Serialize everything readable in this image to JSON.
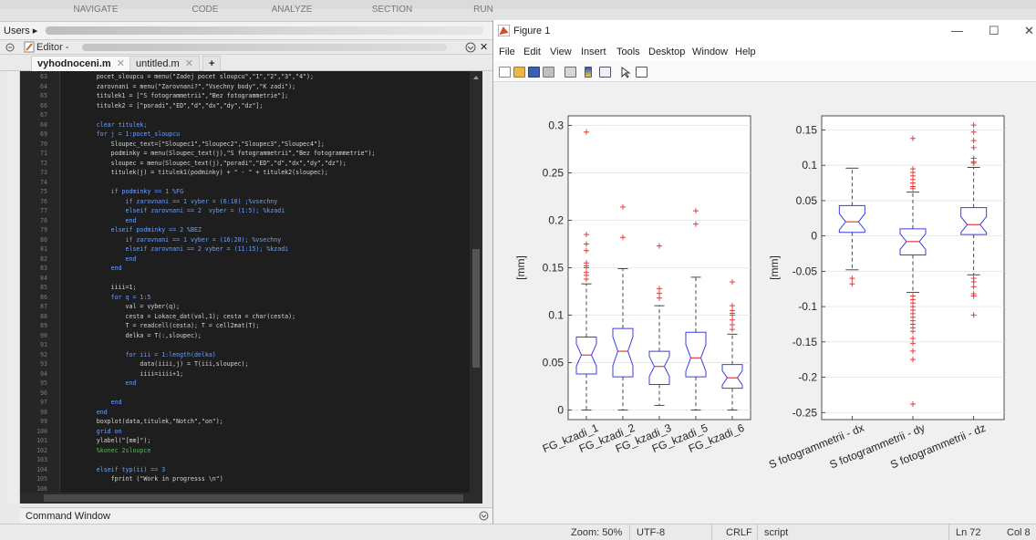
{
  "ribbon": {
    "tabs": [
      "NAVIGATE",
      "CODE",
      "ANALYZE",
      "SECTION",
      "RUN"
    ]
  },
  "path": {
    "label": "Users",
    "arrow": "▸"
  },
  "editor": {
    "title": "Editor -",
    "tabs": [
      {
        "label": "vyhodnoceni.m",
        "active": true
      },
      {
        "label": "untitled.m",
        "active": false
      }
    ],
    "add_tab": "+",
    "close_glyph": "✕",
    "lines": [
      {
        "n": "63",
        "t": "        pocet_sloupcu = menu(\"Zadej pocet sloupcu\",\"1\",\"2\",\"3\",\"4\");"
      },
      {
        "n": "64",
        "t": "        zarovnani = menu(\"Zarovnani?\",\"Vsechny body\",\"K zadi\");"
      },
      {
        "n": "65",
        "t": "        titulek1 = [\"S fotogrammetrii\",\"Bez fotogrammetrie\"];"
      },
      {
        "n": "66",
        "t": "        titulek2 = [\"poradi\",\"ED\",\"d\",\"dx\",\"dy\",\"dz\"];"
      },
      {
        "n": "67",
        "t": ""
      },
      {
        "n": "68",
        "t": "        clear titulek;"
      },
      {
        "n": "69",
        "t": "        for j = 1:pocet_sloupcu"
      },
      {
        "n": "70",
        "t": "            Sloupec_text=[\"Sloupec1\",\"Sloupec2\",\"Sloupec3\",\"Sloupec4\"];"
      },
      {
        "n": "71",
        "t": "            podminky = menu(Sloupec_text(j),\"S fotogrammetrii\",\"Bez fotogrammetrie\");"
      },
      {
        "n": "72",
        "t": "            sloupec = menu(Sloupec_text(j),\"poradi\",\"ED\",\"d\",\"dx\",\"dy\",\"dz\");"
      },
      {
        "n": "73",
        "t": "            titulek(j) = titulek1(podminky) + \" - \" + titulek2(sloupec);"
      },
      {
        "n": "74",
        "t": ""
      },
      {
        "n": "75",
        "t": "            if podminky == 1 %FG"
      },
      {
        "n": "76",
        "t": "                if zarovnani == 1 vyber = (6:10) ;%vsechny"
      },
      {
        "n": "77",
        "t": "                elseif zarovnani == 2  vyber = (1:5); %kzadi"
      },
      {
        "n": "78",
        "t": "                end"
      },
      {
        "n": "79",
        "t": "            elseif podminky == 2 %BEZ"
      },
      {
        "n": "80",
        "t": "                if zarovnani == 1 vyber = (16:20); %vsechny"
      },
      {
        "n": "81",
        "t": "                elseif zarovnani == 2 vyber = (11:15); %kzadi"
      },
      {
        "n": "82",
        "t": "                end"
      },
      {
        "n": "83",
        "t": "            end"
      },
      {
        "n": "84",
        "t": ""
      },
      {
        "n": "85",
        "t": "            iiii=1;"
      },
      {
        "n": "86",
        "t": "            for q = 1:5"
      },
      {
        "n": "87",
        "t": "                val = vyber(q);"
      },
      {
        "n": "88",
        "t": "                cesta = Lokace_dat(val,1); cesta = char(cesta);"
      },
      {
        "n": "89",
        "t": "                T = readcell(cesta); T = cell2mat(T);"
      },
      {
        "n": "90",
        "t": "                delka = T(:,sloupec);"
      },
      {
        "n": "91",
        "t": ""
      },
      {
        "n": "92",
        "t": "                for iii = 1:length(delka)"
      },
      {
        "n": "93",
        "t": "                    data(iiii,j) = T(iii,sloupec);"
      },
      {
        "n": "94",
        "t": "                    iiii=iiii+1;"
      },
      {
        "n": "95",
        "t": "                end"
      },
      {
        "n": "96",
        "t": ""
      },
      {
        "n": "97",
        "t": "            end"
      },
      {
        "n": "98",
        "t": "        end"
      },
      {
        "n": "99",
        "t": "        boxplot(data,titulek,\"Notch\",\"on\");"
      },
      {
        "n": "100",
        "t": "        grid on"
      },
      {
        "n": "101",
        "t": "        ylabel(\"[mm]\");"
      },
      {
        "n": "102",
        "t": "        %konec 2sloupce"
      },
      {
        "n": "103",
        "t": ""
      },
      {
        "n": "104",
        "t": "        elseif typ(ii) == 3"
      },
      {
        "n": "105",
        "t": "            fprint (\"Work in progresss \\n\")"
      },
      {
        "n": "106",
        "t": ""
      },
      {
        "n": "107",
        "t": "        end"
      },
      {
        "n": "108",
        "t": "        clear data;"
      }
    ]
  },
  "command_window": {
    "label": "Command Window"
  },
  "figure": {
    "title": "Figure 1",
    "controls": {
      "minimize": "—",
      "maximize": "☐",
      "close": "✕"
    },
    "menu": [
      "File",
      "Edit",
      "View",
      "Insert",
      "Tools",
      "Desktop",
      "Window",
      "Help"
    ],
    "toolbar_icons": [
      "new-figure-icon",
      "open-file-icon",
      "save-icon",
      "print-icon",
      "link-icon",
      "colorbar-icon",
      "legend-icon",
      "pointer-icon",
      "property-editor-icon"
    ]
  },
  "chart_data": [
    {
      "type": "boxplot",
      "title": "",
      "xlabel": "",
      "ylabel": "[mm]",
      "ylim": [
        -0.01,
        0.31
      ],
      "yticks": [
        0,
        0.05,
        0.1,
        0.15,
        0.2,
        0.25,
        0.3
      ],
      "ytick_labels": [
        "0",
        "0.05",
        "0.1",
        "0.15",
        "0.2",
        "0.25",
        "0.3"
      ],
      "notch": true,
      "grid": true,
      "categories": [
        "FG_kzadi_1",
        "FG_kzadi_2",
        "FG_kzadi_3",
        "FG_kzadi_5",
        "FG_kzadi_6"
      ],
      "boxes": [
        {
          "min": 0.0,
          "q1": 0.038,
          "median": 0.058,
          "q3": 0.077,
          "max": 0.133,
          "outliers": [
            0.138,
            0.142,
            0.145,
            0.15,
            0.152,
            0.155,
            0.168,
            0.175,
            0.185,
            0.293
          ]
        },
        {
          "min": 0.0,
          "q1": 0.035,
          "median": 0.062,
          "q3": 0.086,
          "max": 0.149,
          "outliers": [
            0.182,
            0.214
          ]
        },
        {
          "min": 0.005,
          "q1": 0.027,
          "median": 0.046,
          "q3": 0.062,
          "max": 0.11,
          "outliers": [
            0.118,
            0.123,
            0.128,
            0.173
          ]
        },
        {
          "min": 0.0,
          "q1": 0.035,
          "median": 0.055,
          "q3": 0.082,
          "max": 0.14,
          "outliers": [
            0.196,
            0.21
          ]
        },
        {
          "min": 0.0,
          "q1": 0.023,
          "median": 0.034,
          "q3": 0.048,
          "max": 0.08,
          "outliers": [
            0.085,
            0.09,
            0.095,
            0.1,
            0.102,
            0.105,
            0.11,
            0.135
          ]
        }
      ]
    },
    {
      "type": "boxplot",
      "title": "",
      "xlabel": "",
      "ylabel": "[mm]",
      "ylim": [
        -0.26,
        0.17
      ],
      "yticks": [
        -0.25,
        -0.2,
        -0.15,
        -0.1,
        -0.05,
        0,
        0.05,
        0.1,
        0.15
      ],
      "ytick_labels": [
        "-0.25",
        "-0.2",
        "-0.15",
        "-0.1",
        "-0.05",
        "0",
        "0.05",
        "0.1",
        "0.15"
      ],
      "notch": true,
      "grid": true,
      "categories": [
        "S fotogrammetrii - dx",
        "S fotogrammetrii - dy",
        "S fotogrammetrii - dz"
      ],
      "boxes": [
        {
          "min": -0.048,
          "q1": 0.005,
          "median": 0.02,
          "q3": 0.043,
          "max": 0.096,
          "outliers": [
            -0.06,
            -0.068
          ]
        },
        {
          "min": -0.08,
          "q1": -0.027,
          "median": -0.008,
          "q3": 0.01,
          "max": 0.062,
          "outliers": [
            0.067,
            0.07,
            0.075,
            0.08,
            0.085,
            0.09,
            0.095,
            0.138,
            -0.085,
            -0.09,
            -0.095,
            -0.1,
            -0.105,
            -0.11,
            -0.115,
            -0.12,
            -0.125,
            -0.13,
            -0.135,
            -0.145,
            -0.152,
            -0.163,
            -0.175,
            -0.238
          ]
        },
        {
          "min": -0.055,
          "q1": 0.002,
          "median": 0.016,
          "q3": 0.04,
          "max": 0.097,
          "outliers": [
            0.103,
            0.105,
            0.11,
            0.125,
            0.135,
            0.147,
            0.157,
            -0.06,
            -0.065,
            -0.072,
            -0.082,
            -0.085,
            -0.112
          ]
        }
      ]
    }
  ],
  "status": {
    "zoom": "Zoom: 50%",
    "encoding": "UTF-8",
    "eol": "CRLF",
    "type": "script",
    "ln": "Ln  72",
    "col": "Col  8"
  },
  "colors": {
    "box": "#3c3ce6",
    "median": "#e03c3c",
    "outlier": "#e03c3c",
    "code_bg": "#1e1e1e"
  }
}
